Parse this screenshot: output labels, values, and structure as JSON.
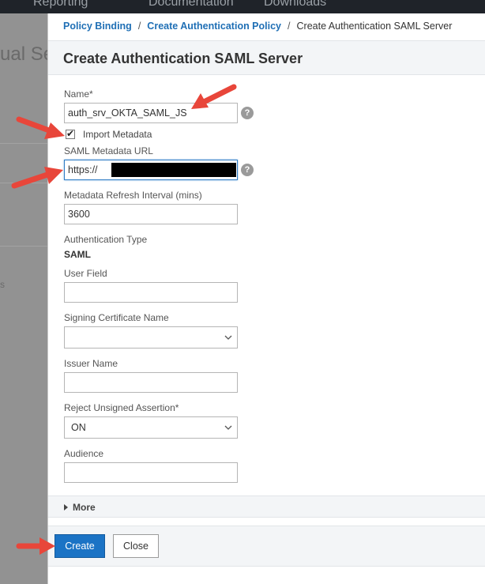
{
  "background": {
    "nav_items": [
      "Reporting",
      "Documentation",
      "Downloads"
    ],
    "title_fragment": "ual Se",
    "stray_text": "s"
  },
  "breadcrumb": {
    "items": [
      "Policy Binding",
      "Create Authentication Policy"
    ],
    "current": "Create Authentication SAML Server"
  },
  "dialog": {
    "title": "Create Authentication SAML Server"
  },
  "form": {
    "name": {
      "label": "Name*",
      "value": "auth_srv_OKTA_SAML_JS"
    },
    "import_metadata": {
      "label": "Import Metadata",
      "checked": true
    },
    "metadata_url": {
      "label": "SAML Metadata URL",
      "value": "https://"
    },
    "refresh_interval": {
      "label": "Metadata Refresh Interval (mins)",
      "value": "3600"
    },
    "auth_type": {
      "label": "Authentication Type",
      "value": "SAML"
    },
    "user_field": {
      "label": "User Field",
      "value": ""
    },
    "signing_cert": {
      "label": "Signing Certificate Name",
      "value": ""
    },
    "issuer_name": {
      "label": "Issuer Name",
      "value": ""
    },
    "reject_unsigned": {
      "label": "Reject Unsigned Assertion*",
      "value": "ON"
    },
    "audience": {
      "label": "Audience",
      "value": ""
    }
  },
  "more": {
    "label": "More"
  },
  "buttons": {
    "create": "Create",
    "close": "Close"
  },
  "help_glyph": "?",
  "icons": {
    "help": "question-circle-icon",
    "dropdown": "chevron-down-icon",
    "expand": "caret-right-icon",
    "annotation": "red-arrow-icon"
  },
  "colors": {
    "accent": "#1b73c5",
    "link": "#1f6fb5",
    "annotation": "#e8463a",
    "panel_header": "#f3f5f7"
  }
}
